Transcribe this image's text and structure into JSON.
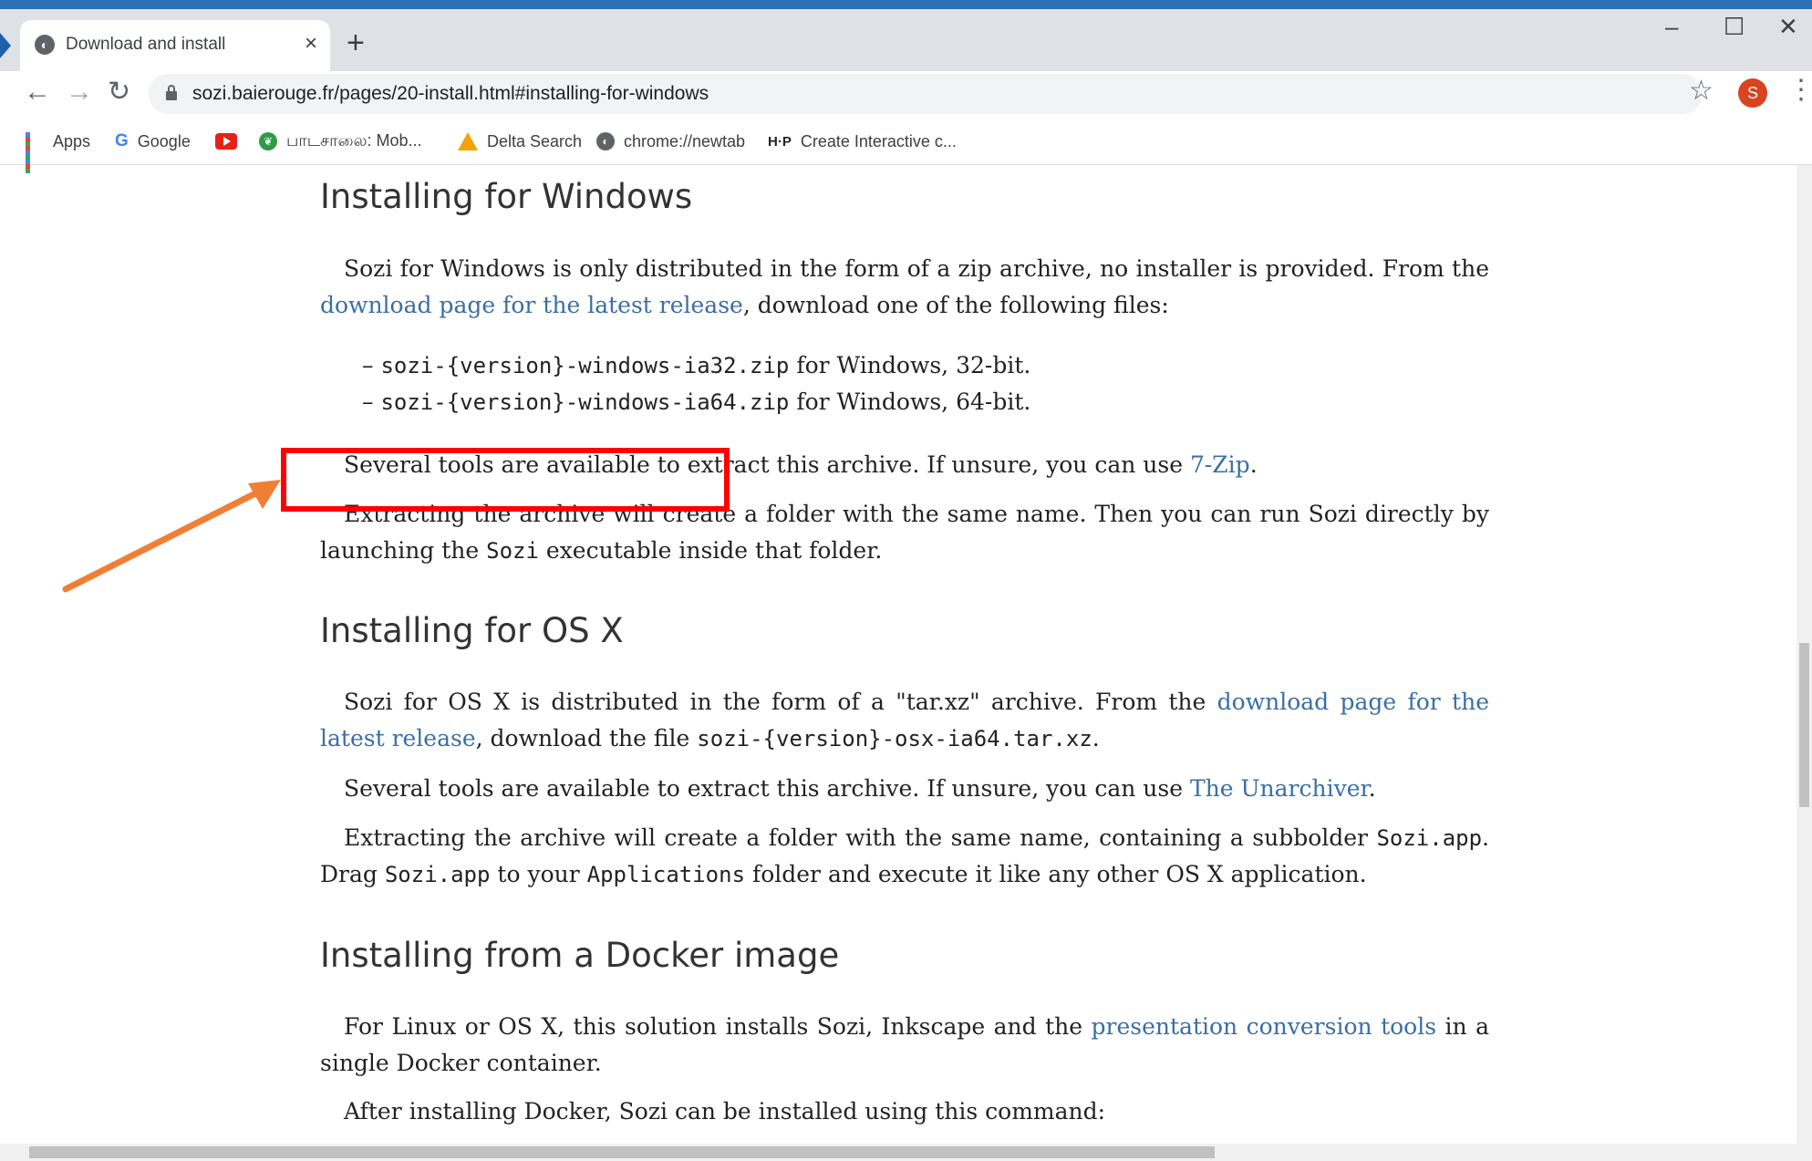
{
  "browser": {
    "tab_title": "Download and install",
    "url": "sozi.baierouge.fr/pages/20-install.html#installing-for-windows",
    "avatar_letter": "S",
    "bookmarks": [
      {
        "label": "Apps",
        "icon": "apps-grid-icon"
      },
      {
        "label": "Google",
        "icon": "google-icon"
      },
      {
        "label": "",
        "icon": "youtube-icon"
      },
      {
        "label": "பாடசாலை: Mob...",
        "icon": "leaf-icon"
      },
      {
        "label": "Delta Search",
        "icon": "delta-icon"
      },
      {
        "label": "chrome://newtab",
        "icon": "globe-icon"
      },
      {
        "label": "Create Interactive c...",
        "icon": "h5p-icon"
      }
    ]
  },
  "content": {
    "windows": {
      "heading": "Installing for Windows",
      "p1_a": "Sozi for Windows is only distributed in the form of a zip archive, no installer is provided. From the",
      "p1_link": "download page for the latest release",
      "p1_b": ", download one of the following files:",
      "files": [
        {
          "code": "sozi-{version}-windows-ia32.zip",
          "text": " for Windows, 32-bit."
        },
        {
          "code": "sozi-{version}-windows-ia64.zip",
          "text": " for Windows, 64-bit."
        }
      ],
      "p2_a": "Several tools are available to extract this archive. If unsure, you can use ",
      "p2_link": "7-Zip",
      "p2_b": ".",
      "p3_a": "Extracting the archive will create a folder with the same name. Then you can run Sozi directly by launching the ",
      "p3_code": "Sozi",
      "p3_b": " executable inside that folder."
    },
    "osx": {
      "heading": "Installing for OS X",
      "p1_a": "Sozi for OS X is distributed in the form of a \"tar.xz\" archive. From the ",
      "p1_link": "download page for the latest release",
      "p1_b": ", download the file ",
      "p1_code": "sozi-{version}-osx-ia64.tar.xz",
      "p1_c": ".",
      "p2_a": "Several tools are available to extract this archive. If unsure, you can use ",
      "p2_link": "The Unarchiver",
      "p2_b": ".",
      "p3_a": "Extracting the archive will create a folder with the same name, containing a subbolder ",
      "p3_code1": "Sozi.app",
      "p3_b": ". Drag ",
      "p3_code2": "Sozi.app",
      "p3_c": " to your ",
      "p3_code3": "Applications",
      "p3_d": " folder and execute it like any other OS X application."
    },
    "docker": {
      "heading": "Installing from a Docker image",
      "p1_a": "For Linux or OS X, this solution installs Sozi, Inkscape and the ",
      "p1_link": "presentation conversion tools",
      "p1_b": " in a single Docker container.",
      "p2": "After installing Docker, Sozi can be installed using this command:"
    }
  },
  "annotation": {
    "box_color": "#ff0000",
    "arrow_color": "#f07f35"
  },
  "colors": {
    "link": "#3a6ea5",
    "accent_bar": "#2f6fb5"
  }
}
